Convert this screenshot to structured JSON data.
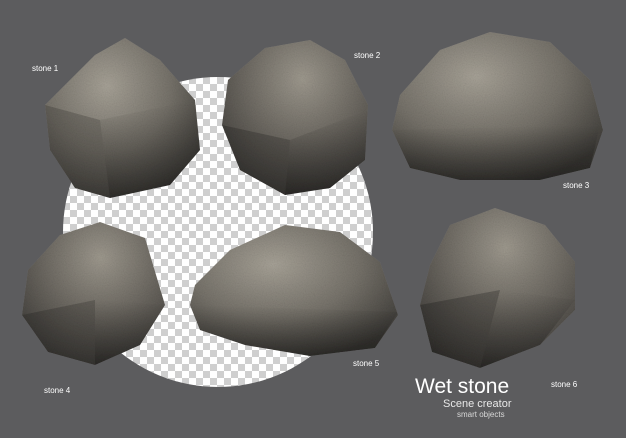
{
  "labels": {
    "stone1": "stone 1",
    "stone2": "stone 2",
    "stone3": "stone 3",
    "stone4": "stone 4",
    "stone5": "stone 5",
    "stone6": "stone 6"
  },
  "title": {
    "main": "Wet stone",
    "sub": "Scene creator",
    "sub2": "smart objects"
  },
  "colors": {
    "background": "#5c5c5e",
    "stone_light": "#9a958c",
    "stone_mid": "#6e6a63",
    "stone_dark": "#3e3c39",
    "checker_light": "#ffffff",
    "checker_dark": "#cfcfcf"
  }
}
